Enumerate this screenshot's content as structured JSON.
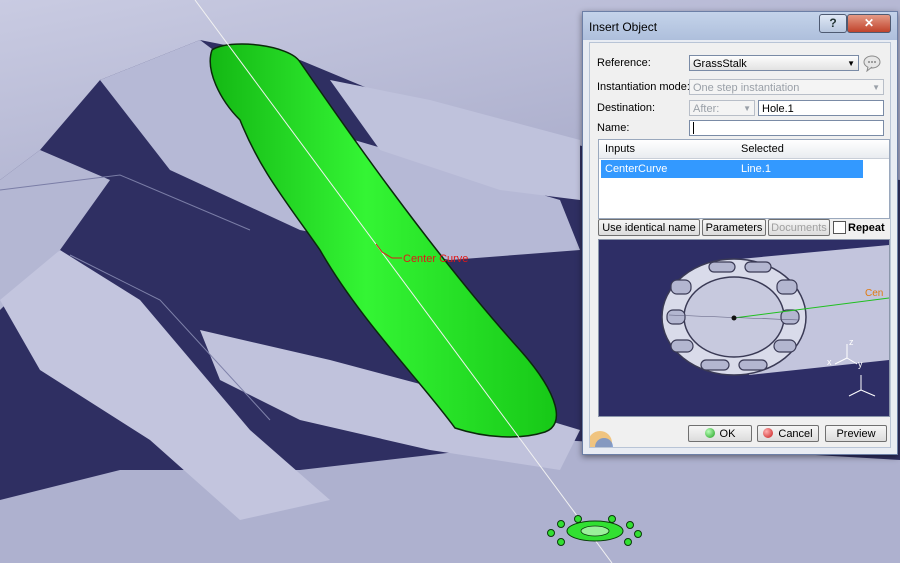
{
  "viewport": {
    "annotation": "Center Curve",
    "colors": {
      "background": "#2f2f62",
      "surface": "#b9bcd8",
      "highlight": "#1edc1e",
      "annotation": "#e01818"
    }
  },
  "dialog": {
    "title": "Insert Object",
    "help_glyph": "?",
    "close_glyph": "✕",
    "reference": {
      "label": "Reference:",
      "value": "GrassStalk"
    },
    "instantiation": {
      "label": "Instantiation mode:",
      "value": "One step instantiation"
    },
    "destination": {
      "label": "Destination:",
      "mode": "After:",
      "value": "Hole.1"
    },
    "name": {
      "label": "Name:",
      "value": ""
    },
    "table": {
      "headers": [
        "Inputs",
        "Selected"
      ],
      "rows": [
        {
          "input": "CenterCurve",
          "selected": "Line.1"
        }
      ]
    },
    "buttons": {
      "use_identical_name": "Use identical name",
      "parameters": "Parameters",
      "documents": "Documents",
      "repeat": "Repeat",
      "ok": "OK",
      "cancel": "Cancel",
      "preview": "Preview"
    },
    "preview_image": {
      "curve_label": "Cen",
      "axis_labels": [
        "x",
        "y",
        "z"
      ]
    }
  }
}
